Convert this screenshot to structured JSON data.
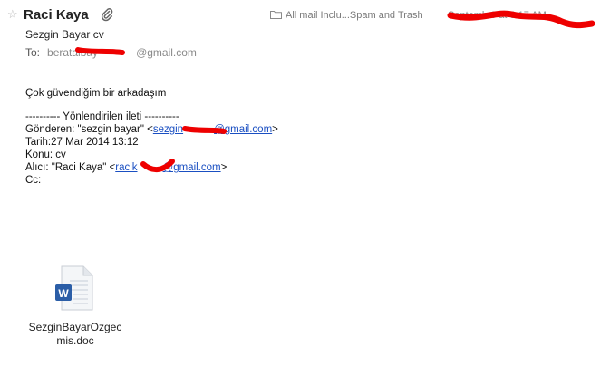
{
  "header": {
    "star_glyph": "☆",
    "sender": "Raci Kaya",
    "mailbox": "All mail Inclu...Spam and Trash",
    "date_visible": "Septemb        6 at 8:17 AM"
  },
  "subject": "Sezgin Bayar cv",
  "to": {
    "label": "To:",
    "prefix": "beratalbay",
    "suffix": "@gmail.com"
  },
  "body": {
    "greeting": "Çok güvendiğim bir arkadaşım",
    "forward_header": "---------- Yönlendirilen ileti ----------",
    "from_label": "Gönderen: \"sezgin bayar\" <",
    "from_link_start": "sezgin",
    "from_link_end": "@gmail.com",
    "from_close": ">",
    "date_line": "Tarih:27 Mar 2014 13:12",
    "subject_line": "Konu: cv",
    "to_label": "Alıcı: \"Raci Kaya\" <",
    "to_link_start": "racik",
    "to_link_end": "@gmail.com",
    "to_close": ">",
    "cc_line": "Cc:"
  },
  "attachment": {
    "filename": "SezginBayarOzgecmis.doc",
    "icon": "word-document-icon"
  },
  "colors": {
    "link": "#1a4fc2",
    "redaction": "#ee0000"
  }
}
